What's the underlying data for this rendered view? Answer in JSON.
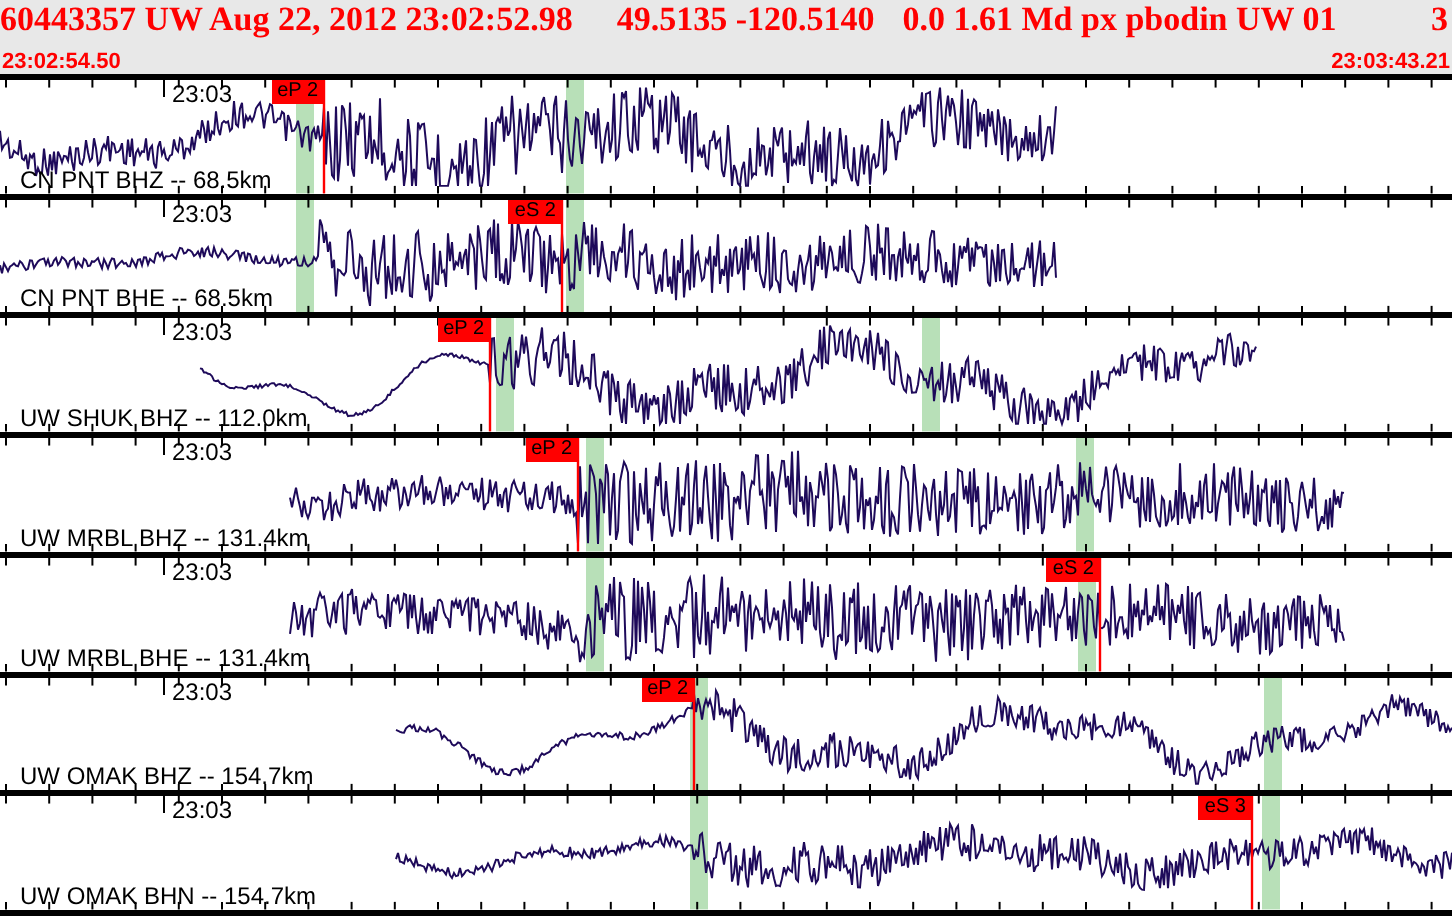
{
  "header": {
    "event": "60443357 UW Aug 22, 2012 23:02:52.98",
    "location": "49.5135 -120.5140",
    "solution": "0.0 1.61 Md px pbodin UW 01",
    "column_5": "3",
    "start_time": "23:02:54.50",
    "end_time": "23:03:43.21"
  },
  "channels": [
    {
      "label": "CN PNT BHZ -- 68.5km",
      "time_label": "23:03",
      "picks": [
        {
          "label": "eP 2"
        }
      ]
    },
    {
      "label": "CN PNT BHE -- 68.5km",
      "time_label": "23:03",
      "picks": [
        {
          "label": "eS 2"
        }
      ]
    },
    {
      "label": "UW SHUK BHZ -- 112.0km",
      "time_label": "23:03",
      "picks": [
        {
          "label": "eP 2"
        }
      ]
    },
    {
      "label": "UW MRBL BHZ -- 131.4km",
      "time_label": "23:03",
      "picks": [
        {
          "label": "eP 2"
        }
      ]
    },
    {
      "label": "UW MRBL BHE -- 131.4km",
      "time_label": "23:03",
      "picks": [
        {
          "label": "eS 2"
        }
      ]
    },
    {
      "label": "UW OMAK BHZ -- 154.7km",
      "time_label": "23:03",
      "picks": [
        {
          "label": "eP 2"
        }
      ]
    },
    {
      "label": "UW OMAK BHN -- 154.7km",
      "time_label": "23:03",
      "picks": [
        {
          "label": "eS 3"
        }
      ]
    }
  ]
}
